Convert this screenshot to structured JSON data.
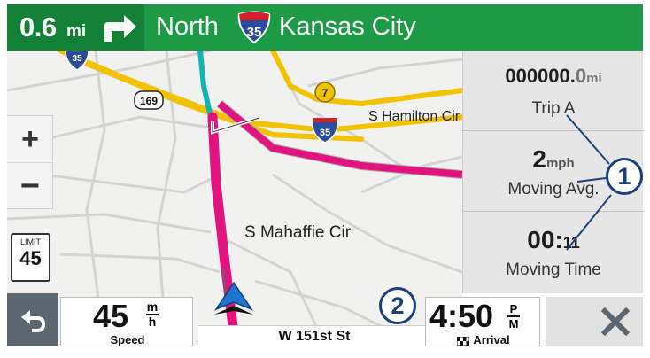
{
  "nav_banner": {
    "distance_value": "0.6",
    "distance_unit": "mi",
    "street_pre": "North",
    "highway_number": "35",
    "street_post": "Kansas City"
  },
  "map": {
    "labels": {
      "hamilton": "S Hamilton Cir",
      "mahaffie": "S Mahaffie Cir"
    },
    "shields": {
      "interstate_top": "35",
      "us_route": "169",
      "state_route": "7",
      "interstate_mid": "35"
    },
    "colors": {
      "route": "#e0137f",
      "highway": "#f2c200",
      "teal_road": "#14b3b3"
    }
  },
  "zoom": {
    "in_label": "+",
    "out_label": "−"
  },
  "speed_limit": {
    "label": "LIMIT",
    "value": "45"
  },
  "trip_fields": [
    {
      "value": "000000.",
      "value_dim": "0",
      "unit": "mi",
      "label": "Trip A"
    },
    {
      "value": "2",
      "value_dim": "",
      "unit": "mph",
      "label": "Moving Avg."
    },
    {
      "value": "00:",
      "value_dim": "",
      "unit": "11",
      "label": "Moving Time"
    }
  ],
  "callouts": {
    "one": "1",
    "two": "2"
  },
  "bottom_bar": {
    "speed_value": "45",
    "speed_unit_top": "m",
    "speed_unit_bottom": "h",
    "speed_label": "Speed",
    "street": "W 151st St",
    "arrival_value": "4:50",
    "arrival_ampm_top": "P",
    "arrival_ampm_bottom": "M",
    "arrival_label": "Arrival"
  }
}
